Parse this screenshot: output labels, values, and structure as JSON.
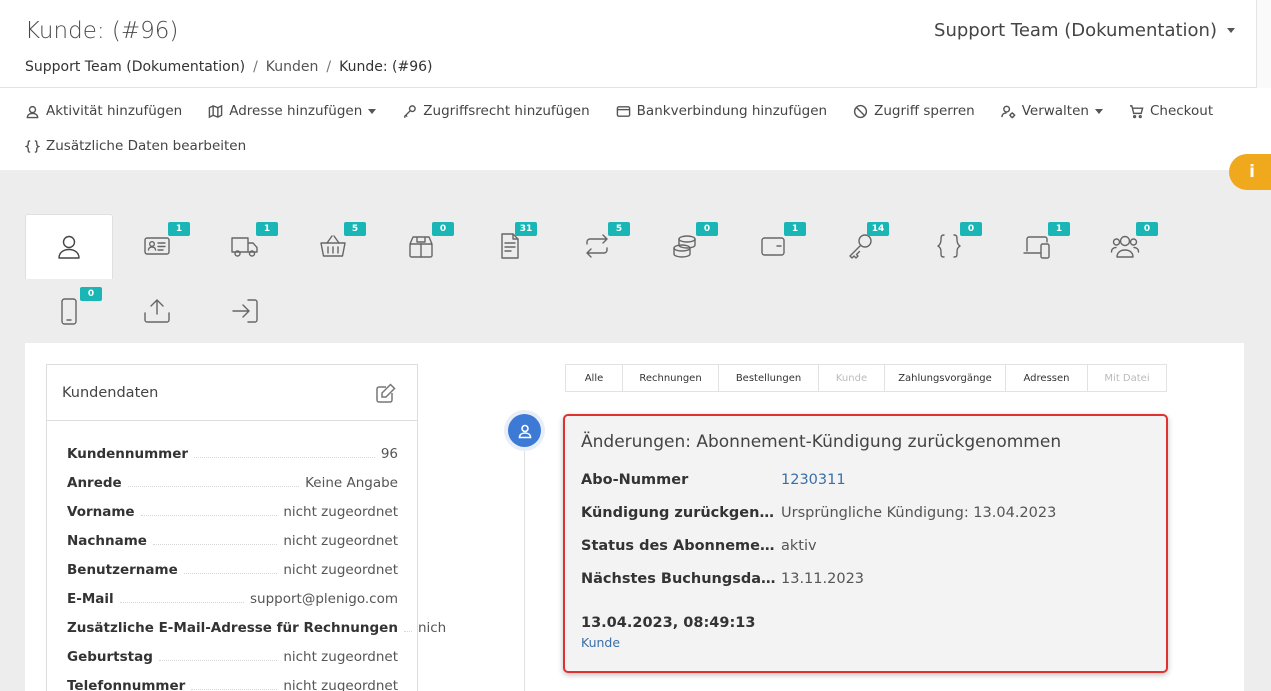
{
  "header": {
    "title": "Kunde: (#96)",
    "account": "Support Team (Dokumentation)",
    "breadcrumb": [
      "Support Team (Dokumentation)",
      "Kunden",
      "Kunde: (#96)"
    ]
  },
  "toolbar": {
    "activity": "Aktivität hinzufügen",
    "address": "Adresse hinzufügen",
    "access_right": "Zugriffsrecht hinzufügen",
    "bank": "Bankverbindung hinzufügen",
    "block": "Zugriff sperren",
    "manage": "Verwalten",
    "checkout": "Checkout",
    "extra_data": "Zusätzliche Daten bearbeiten"
  },
  "info_tab": "i",
  "tabs": [
    {
      "icon": "user-icon",
      "badge": ""
    },
    {
      "icon": "id-card-icon",
      "badge": "1"
    },
    {
      "icon": "truck-icon",
      "badge": "1"
    },
    {
      "icon": "basket-icon",
      "badge": "5"
    },
    {
      "icon": "box-icon",
      "badge": "0"
    },
    {
      "icon": "invoice-icon",
      "badge": "31"
    },
    {
      "icon": "repeat-icon",
      "badge": "5"
    },
    {
      "icon": "coins-icon",
      "badge": "0"
    },
    {
      "icon": "wallet-icon",
      "badge": "1"
    },
    {
      "icon": "key-icon",
      "badge": "14"
    },
    {
      "icon": "braces-icon",
      "badge": "0"
    },
    {
      "icon": "devices-icon",
      "badge": "1"
    },
    {
      "icon": "users-icon",
      "badge": "0"
    },
    {
      "icon": "phone-icon",
      "badge": "0"
    },
    {
      "icon": "upload-icon",
      "badge": ""
    },
    {
      "icon": "login-icon",
      "badge": ""
    }
  ],
  "customer": {
    "card_title": "Kundendaten",
    "fields": [
      {
        "label": "Kundennummer",
        "value": "96"
      },
      {
        "label": "Anrede",
        "value": "Keine Angabe"
      },
      {
        "label": "Vorname",
        "value": "nicht zugeordnet"
      },
      {
        "label": "Nachname",
        "value": "nicht zugeordnet"
      },
      {
        "label": "Benutzername",
        "value": "nicht zugeordnet"
      },
      {
        "label": "E-Mail",
        "value": "support@plenigo.com"
      },
      {
        "label": "Zusätzliche E-Mail-Adresse für Rechnungen",
        "value": "nich"
      },
      {
        "label": "Geburtstag",
        "value": "nicht zugeordnet"
      },
      {
        "label": "Telefonnummer",
        "value": "nicht zugeordnet"
      }
    ]
  },
  "filters": [
    {
      "label": "Alle",
      "disabled": false
    },
    {
      "label": "Rechnungen",
      "disabled": false
    },
    {
      "label": "Bestellungen",
      "disabled": false
    },
    {
      "label": "Kunde",
      "disabled": true
    },
    {
      "label": "Zahlungsvorgänge",
      "disabled": false
    },
    {
      "label": "Adressen",
      "disabled": false
    },
    {
      "label": "Mit Datei",
      "disabled": true
    }
  ],
  "event": {
    "title": "Änderungen: Abonnement-Kündigung zurückgenommen",
    "rows": [
      {
        "label": "Abo-Nummer",
        "value": "1230311"
      },
      {
        "label": "Kündigung zurückgenommen",
        "value": "Ursprüngliche Kündigung: 13.04.2023"
      },
      {
        "label": "Status des Abonnements",
        "value": "aktiv"
      },
      {
        "label": "Nächstes Buchungsdatum",
        "value": "13.11.2023"
      }
    ],
    "timestamp": "13.04.2023, 08:49:13",
    "author": "Kunde"
  },
  "colors": {
    "accent": "#1ab5b5",
    "info": "#f0a81c",
    "highlight": "#e03131",
    "link": "#3a6ea8"
  }
}
